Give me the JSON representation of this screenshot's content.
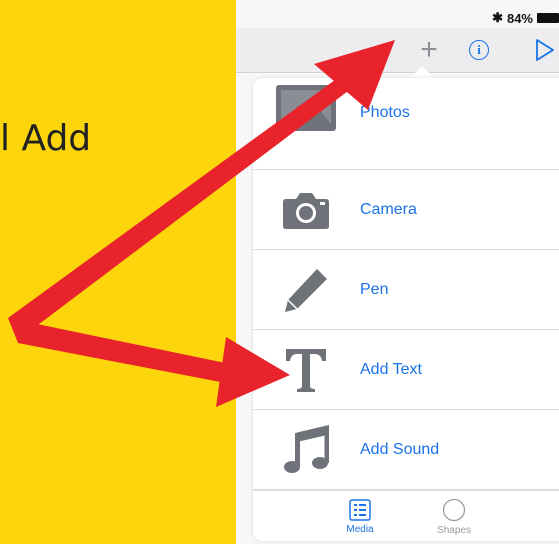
{
  "slide": {
    "caption": "l Add"
  },
  "status_bar": {
    "bluetooth": "✱",
    "battery": "84%"
  },
  "toolbar": {
    "add": "+",
    "info": "i"
  },
  "menu": {
    "items": [
      {
        "label": "Photos",
        "icon": "photo-icon"
      },
      {
        "label": "Camera",
        "icon": "camera-icon"
      },
      {
        "label": "Pen",
        "icon": "pen-icon"
      },
      {
        "label": "Add Text",
        "icon": "text-icon"
      },
      {
        "label": "Add Sound",
        "icon": "music-note-icon"
      }
    ]
  },
  "tabs": [
    {
      "label": "Media",
      "active": true
    },
    {
      "label": "Shapes",
      "active": false
    }
  ],
  "colors": {
    "accent": "#1a73e8",
    "slide_background": "#fdd50c",
    "annotation_arrow": "#e8232b",
    "icon_gray": "#6f7379"
  }
}
